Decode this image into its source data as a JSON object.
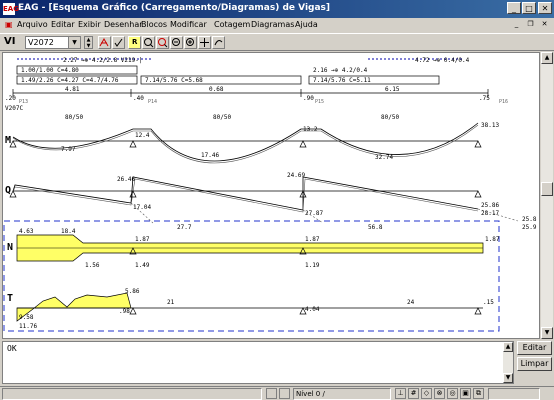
{
  "window": {
    "app_icon": "EAG",
    "title": "EAG - [Esquema Gráfico (Carregamento/Diagramas) de Vigas]",
    "controls": [
      "_",
      "□",
      "✕"
    ]
  },
  "menu": [
    "Arquivo",
    "Editar",
    "Exibir",
    "Desenhar",
    "Blocos",
    "Modificar",
    "Cotagem",
    "Diagramas",
    "Ajuda"
  ],
  "toolbar": {
    "label": "VI",
    "beam_select": "V2072",
    "tool_icons": [
      "beam-section-icon",
      "check-icon",
      "r-icon",
      "zoom-in-icon",
      "zoom-window-icon",
      "zoom-all-icon",
      "zoom-out-icon",
      "pan-icon",
      "redraw-icon"
    ]
  },
  "drawing": {
    "beam_name": "V207C",
    "loads": {
      "left_top": "2.27 →⊕ 4.2/2.8  V219-|",
      "right_top": "4.72 →⊕ 0.4/0.4",
      "box1_line1": "1.00/1.00  C=4.80",
      "box1_line2": "1.49/2.26 C=4.27  C=4.7/4.76",
      "box2": "7.14/5.76  C=5.68",
      "box3_line1": "2.16 →⊕ 4.2/0.4",
      "box3_line2": "7.14/5.76  C=5.11"
    },
    "dims": {
      "left_start": ".20",
      "span1": "4.81",
      "sup1": ".40",
      "span2": "0.68",
      "sup2": ".90",
      "span3": "6.15",
      "right_end": ".75",
      "p_left": "P13",
      "p1": "P14",
      "p2": "P15",
      "p3": "P16"
    },
    "sections": [
      "80/50",
      "80/50",
      "80/50"
    ],
    "diagrams": {
      "moment_label": "M",
      "moment_values": [
        "7.97",
        "12.4",
        "17.46",
        "13.2",
        "32.74",
        "38.13"
      ],
      "shear_label": "Q",
      "shear_values": [
        "26.46",
        "17.04",
        "27.7",
        "24.69",
        "27.87",
        "56.8",
        "25.86",
        "28.17",
        "25.8",
        "25.9"
      ],
      "normal_label": "N",
      "normal_values": [
        "4.63",
        "18.4",
        "1.56",
        "1.87",
        "1.49",
        "1.87",
        "1.19",
        "1.87"
      ],
      "torsion_label": "T",
      "torsion_values": [
        "9.58",
        "11.76",
        "5.86",
        ".98",
        "21",
        "4.04",
        "24",
        ".15"
      ]
    }
  },
  "console": {
    "text": "OK",
    "edit_button": "Editar",
    "clear_button": "Limpar"
  },
  "status": {
    "level": "Nível 0 /"
  }
}
